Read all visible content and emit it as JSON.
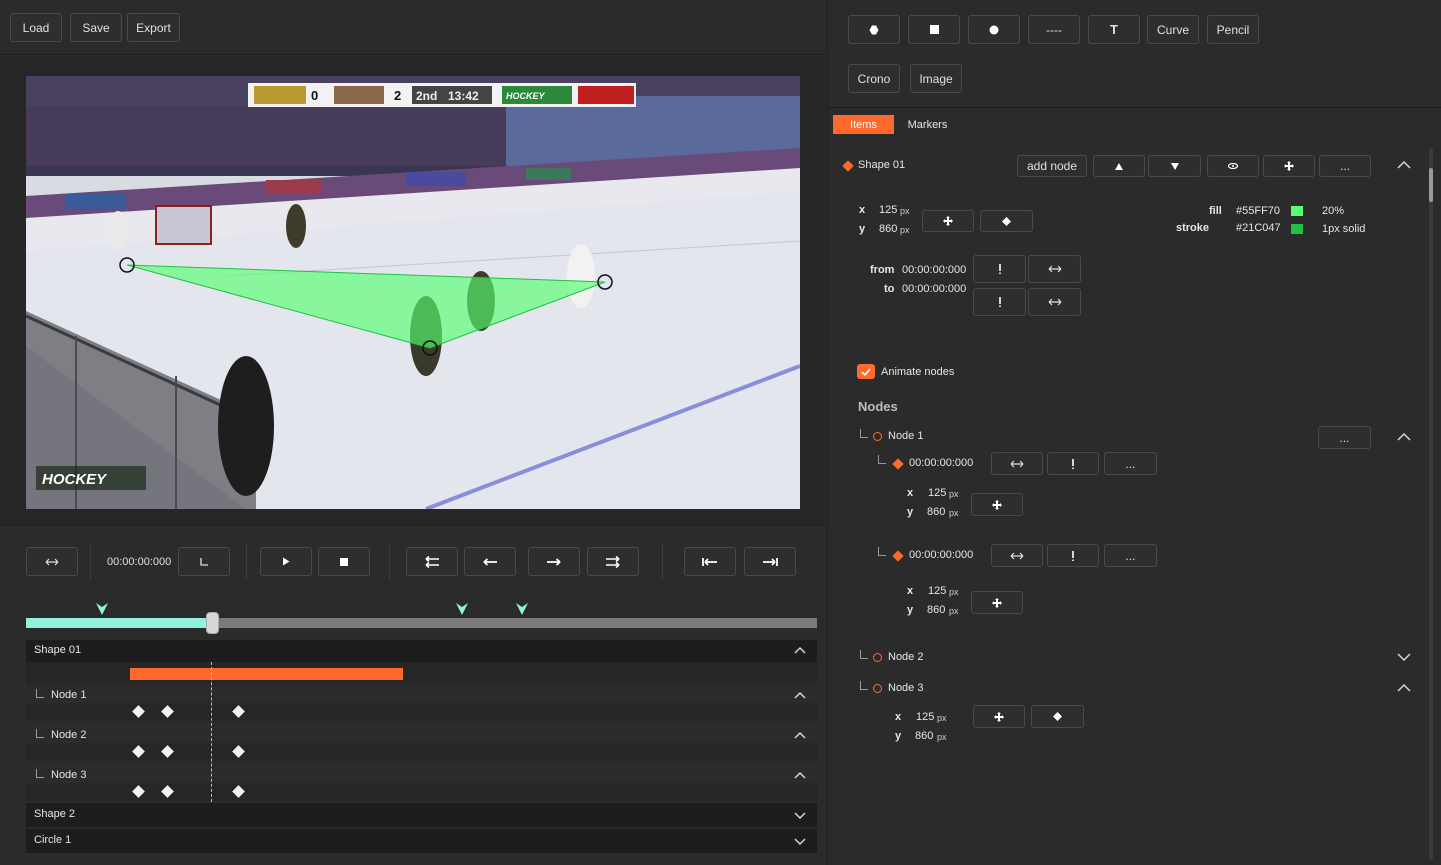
{
  "toolbar": {
    "load": "Load",
    "save": "Save",
    "export": "Export"
  },
  "video": {
    "scoreboard": {
      "team1_score": "0",
      "team2_score": "2",
      "period": "2nd",
      "clock": "13:42",
      "network": "HOCKEY"
    },
    "watermark": "HOCKEY",
    "shape_fill_color": "#55FF70",
    "shape_stroke_color": "#21C047"
  },
  "playback": {
    "current_time": "00:00:00:000",
    "progress": 0.235,
    "markers": [
      0.096,
      0.551,
      0.627
    ]
  },
  "timeline": {
    "rows": [
      {
        "label": "Shape 01",
        "expanded": true
      },
      {
        "label": "Node 1",
        "expanded": true
      },
      {
        "label": "Node 2",
        "expanded": true
      },
      {
        "label": "Node 3",
        "expanded": true
      },
      {
        "label": "Shape 2",
        "expanded": false
      },
      {
        "label": "Circle 1",
        "expanded": false
      }
    ]
  },
  "tools": {
    "text": "T",
    "curve": "Curve",
    "pencil": "Pencil",
    "crono": "Crono",
    "image": "Image",
    "line": "----"
  },
  "tabs": {
    "items": "Items",
    "markers": "Markers"
  },
  "shape": {
    "name": "Shape 01",
    "add_node": "add node",
    "more": "...",
    "x_label": "x",
    "x_value": "125",
    "x_unit": "px",
    "y_label": "y",
    "y_value": "860",
    "y_unit": "px",
    "fill_label": "fill",
    "fill_value": "#55FF70",
    "fill_opacity": "20%",
    "stroke_label": "stroke",
    "stroke_value": "#21C047",
    "stroke_style": "1px solid",
    "from_label": "from",
    "from_value": "00:00:00:000",
    "to_label": "to",
    "to_value": "00:00:00:000",
    "animate_label": "Animate nodes",
    "nodes_title": "Nodes"
  },
  "nodes": {
    "node1": {
      "label": "Node 1",
      "more": "...",
      "keyframes": [
        {
          "time": "00:00:00:000",
          "x": "125",
          "y": "860",
          "unit": "px",
          "more": "..."
        },
        {
          "time": "00:00:00:000",
          "x": "125",
          "y": "860",
          "unit": "px",
          "more": "..."
        }
      ]
    },
    "node2": {
      "label": "Node 2"
    },
    "node3": {
      "label": "Node 3",
      "x": "125",
      "y": "860",
      "unit": "px"
    }
  },
  "labels": {
    "x": "x",
    "y": "y"
  }
}
